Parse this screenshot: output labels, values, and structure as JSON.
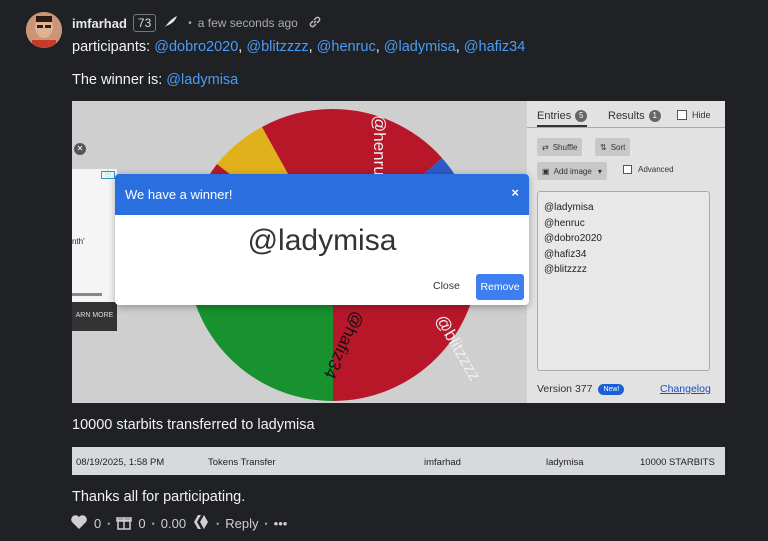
{
  "header": {
    "username": "imfarhad",
    "reputation": "73",
    "time": "a few seconds ago"
  },
  "post": {
    "participants_label": "participants: ",
    "participants": [
      "@dobro2020",
      "@blitzzzz",
      "@henruc",
      "@ladymisa",
      "@hafiz34"
    ],
    "winner_label": "The winner is: ",
    "winner": "@ladymisa",
    "transfer_text": "10000 starbits transferred to ladymisa",
    "thanks_text": "Thanks all for participating."
  },
  "wheel_embed": {
    "tabs": {
      "entries": "Entries",
      "entries_count": "5",
      "results": "Results",
      "results_count": "1",
      "hide": "Hide"
    },
    "buttons": {
      "shuffle": "Shuffle",
      "sort": "Sort",
      "add_image": "Add image",
      "advanced": "Advanced"
    },
    "entries": [
      "@ladymisa",
      "@henruc",
      "@dobro2020",
      "@hafiz34",
      "@blitzzzz"
    ],
    "version": "Version 377",
    "new_badge": "New!",
    "changelog": "Changelog",
    "wheel_labels": [
      "@henruc",
      "@blitzzzz",
      "@hafiz34"
    ],
    "ad_text": "nth'",
    "ad_button": "ARN MORE",
    "colors": {
      "red": "#b8172a",
      "blue": "#2e59c9",
      "green": "#17922f",
      "yellow": "#e0b11a"
    },
    "modal": {
      "title": "We have a winner!",
      "close_icon": "×",
      "winner": "@ladymisa",
      "close": "Close",
      "remove": "Remove"
    }
  },
  "transaction": {
    "date": "08/19/2025, 1:58 PM",
    "type": "Tokens Transfer",
    "from": "imfarhad",
    "to": "ladymisa",
    "amount": "10000 STARBITS"
  },
  "footer": {
    "likes": "0",
    "gifts": "0",
    "payout": "0.00",
    "reply": "Reply",
    "more": "•••"
  }
}
